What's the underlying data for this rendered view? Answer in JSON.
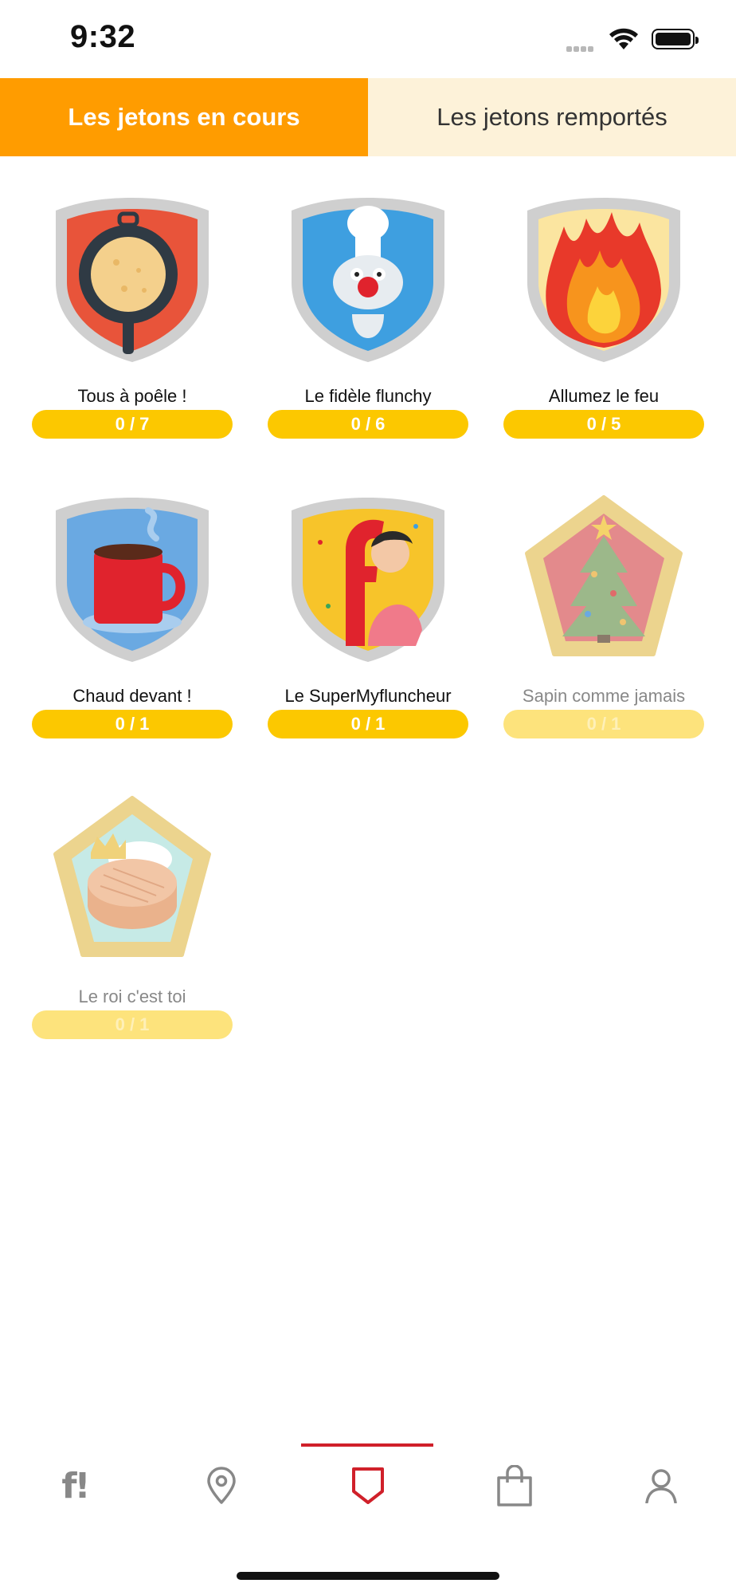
{
  "status_bar": {
    "time": "9:32"
  },
  "tabs": [
    {
      "label": "Les jetons en cours",
      "active": true
    },
    {
      "label": "Les jetons remportés",
      "active": false
    }
  ],
  "badges": [
    {
      "title": "Tous à poêle !",
      "progress": "0 / 7",
      "icon": "frying-pan-icon",
      "shape": "shield",
      "color": "#e8543a",
      "enabled": true
    },
    {
      "title": "Le fidèle flunchy",
      "progress": "0 / 6",
      "icon": "mascot-chef-icon",
      "shape": "shield",
      "color": "#3e9fe0",
      "enabled": true
    },
    {
      "title": "Allumez le feu",
      "progress": "0 / 5",
      "icon": "fire-icon",
      "shape": "shield",
      "color": "#f5c84a",
      "enabled": true
    },
    {
      "title": "Chaud devant !",
      "progress": "0 / 1",
      "icon": "coffee-mug-icon",
      "shape": "shield",
      "color": "#6aa9e2",
      "enabled": true
    },
    {
      "title": "Le SuperMyfluncheur",
      "progress": "0 / 1",
      "icon": "person-hugging-letter-icon",
      "shape": "shield",
      "color": "#f7c42a",
      "enabled": true
    },
    {
      "title": "Sapin comme jamais",
      "progress": "0 / 1",
      "icon": "christmas-tree-icon",
      "shape": "pentagon",
      "color": "#e38a8c",
      "enabled": false
    },
    {
      "title": "Le roi c'est toi",
      "progress": "0 / 1",
      "icon": "galette-crown-icon",
      "shape": "pentagon",
      "color": "#c6eae6",
      "enabled": false
    }
  ],
  "bottom_nav": {
    "logo_text": "f!",
    "items": [
      "home-logo-icon",
      "location-pin-icon",
      "badge-shield-icon",
      "shopping-bag-icon",
      "profile-icon"
    ],
    "active_index": 2
  },
  "colors": {
    "accent": "#ff9c00",
    "tab_inactive_bg": "#fdf2d9",
    "progress": "#fcc800",
    "nav_active": "#d0202a"
  }
}
